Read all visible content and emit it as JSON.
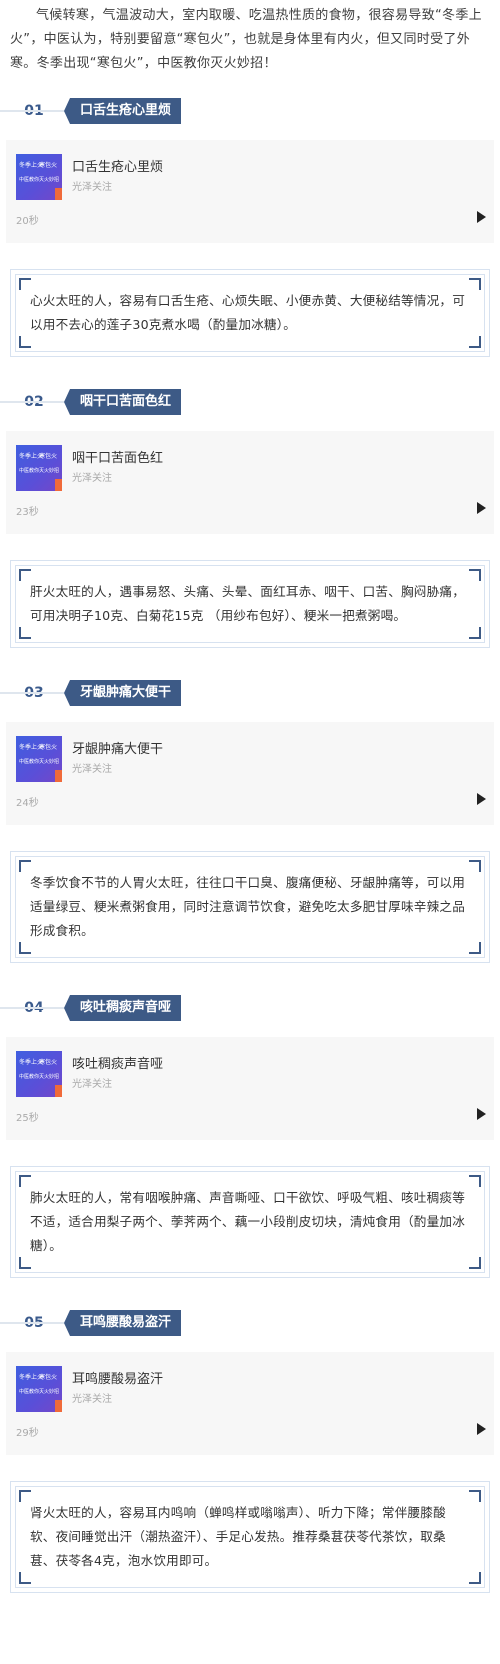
{
  "intro": "气候转寒，气温波动大，室内取暖、吃温热性质的食物，很容易导致“冬季上火”，中医认为，特别要留意“寒包火”，也就是身体里有内火，但又同时受了外寒。冬季出现“寒包火”，中医教你灭火妙招！",
  "colors": {
    "accent": "#3d5a86",
    "box_border": "#d7e2f0",
    "card_bg": "#f7f7f7"
  },
  "thumbnail": {
    "left": "冬季上火",
    "right": "寒包火",
    "bottom": "中医教你灭火妙招"
  },
  "sections": [
    {
      "number": "01",
      "tag": "口舌生疮心里烦",
      "video": {
        "title": "口舌生疮心里烦",
        "author": "光泽关注",
        "duration": "20秒",
        "play_icon": "play-icon"
      },
      "text": "心火太旺的人，容易有口舌生疮、心烦失眠、小便赤黄、大便秘结等情况，可以用不去心的莲子30克煮水喝（酌量加冰糖）。"
    },
    {
      "number": "02",
      "tag": "咽干口苦面色红",
      "video": {
        "title": "咽干口苦面色红",
        "author": "光泽关注",
        "duration": "23秒",
        "play_icon": "play-icon"
      },
      "text": "肝火太旺的人，遇事易怒、头痛、头晕、面红耳赤、咽干、口苦、胸闷胁痛，可用决明子10克、白菊花15克 （用纱布包好）、粳米一把煮粥喝。"
    },
    {
      "number": "03",
      "tag": "牙龈肿痛大便干",
      "video": {
        "title": "牙龈肿痛大便干",
        "author": "光泽关注",
        "duration": "24秒",
        "play_icon": "play-icon"
      },
      "text": "冬季饮食不节的人胃火太旺，往往口干口臭、腹痛便秘、牙龈肿痛等，可以用适量绿豆、粳米煮粥食用，同时注意调节饮食，避免吃太多肥甘厚味辛辣之品形成食积。"
    },
    {
      "number": "04",
      "tag": "咳吐稠痰声音哑",
      "video": {
        "title": "咳吐稠痰声音哑",
        "author": "光泽关注",
        "duration": "25秒",
        "play_icon": "play-icon"
      },
      "text": "肺火太旺的人，常有咽喉肿痛、声音嘶哑、口干欲饮、呼吸气粗、咳吐稠痰等不适，适合用梨子两个、荸荠两个、藕一小段削皮切块，清炖食用（酌量加冰糖）。"
    },
    {
      "number": "05",
      "tag": "耳鸣腰酸易盗汗",
      "video": {
        "title": "耳鸣腰酸易盗汗",
        "author": "光泽关注",
        "duration": "29秒",
        "play_icon": "play-icon"
      },
      "text": "肾火太旺的人，容易耳内鸣响（蝉鸣样或嗡嗡声）、听力下降；常伴腰膝酸软、夜间睡觉出汗（潮热盗汗）、手足心发热。推荐桑葚茯苓代茶饮，取桑葚、茯苓各4克，泡水饮用即可。"
    }
  ]
}
